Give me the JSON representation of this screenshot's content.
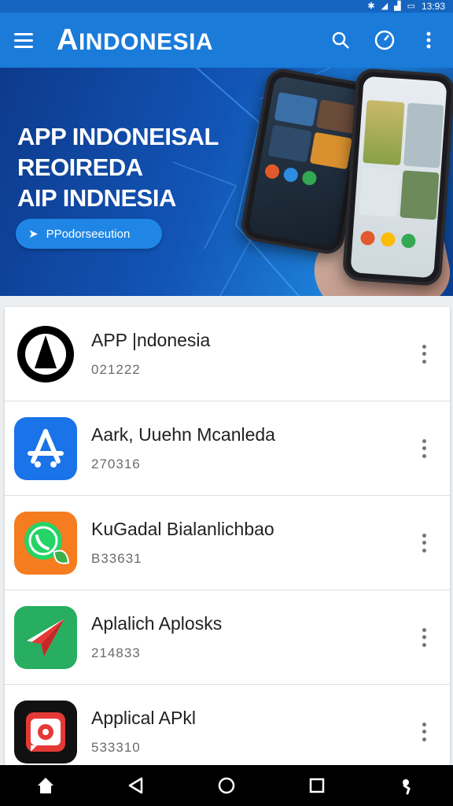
{
  "status_bar": {
    "time": "13:93"
  },
  "app_bar": {
    "brand_prefix": "A",
    "brand_rest": "INDONESIA"
  },
  "banner": {
    "line1": "APP INDONEISAL",
    "line2": "REOIREDA",
    "line3": "AIP INDNESIA",
    "button_label": "PPodorseeution"
  },
  "apps": [
    {
      "title": "APP |ndonesia",
      "subtitle": "021222",
      "icon": "black-tent-icon",
      "color": "#000000"
    },
    {
      "title": "Aark, Uuehn Mcanleda",
      "subtitle": "270316",
      "icon": "app-store-icon",
      "color": "#1a73e8"
    },
    {
      "title": "KuGadal Bialanlichbao",
      "subtitle": "B33631",
      "icon": "whatsapp-leaf-icon",
      "color": "#f57c1f"
    },
    {
      "title": "Aplalich Aplosks",
      "subtitle": "214833",
      "icon": "paper-plane-icon",
      "color": "#27ae60"
    },
    {
      "title": "Applical APkl",
      "subtitle": "533310",
      "icon": "camera-icon",
      "color": "#e53935"
    }
  ],
  "nav": {
    "icons": [
      "home-icon",
      "back-icon",
      "home-circle-icon",
      "recents-icon",
      "assistant-icon"
    ]
  }
}
